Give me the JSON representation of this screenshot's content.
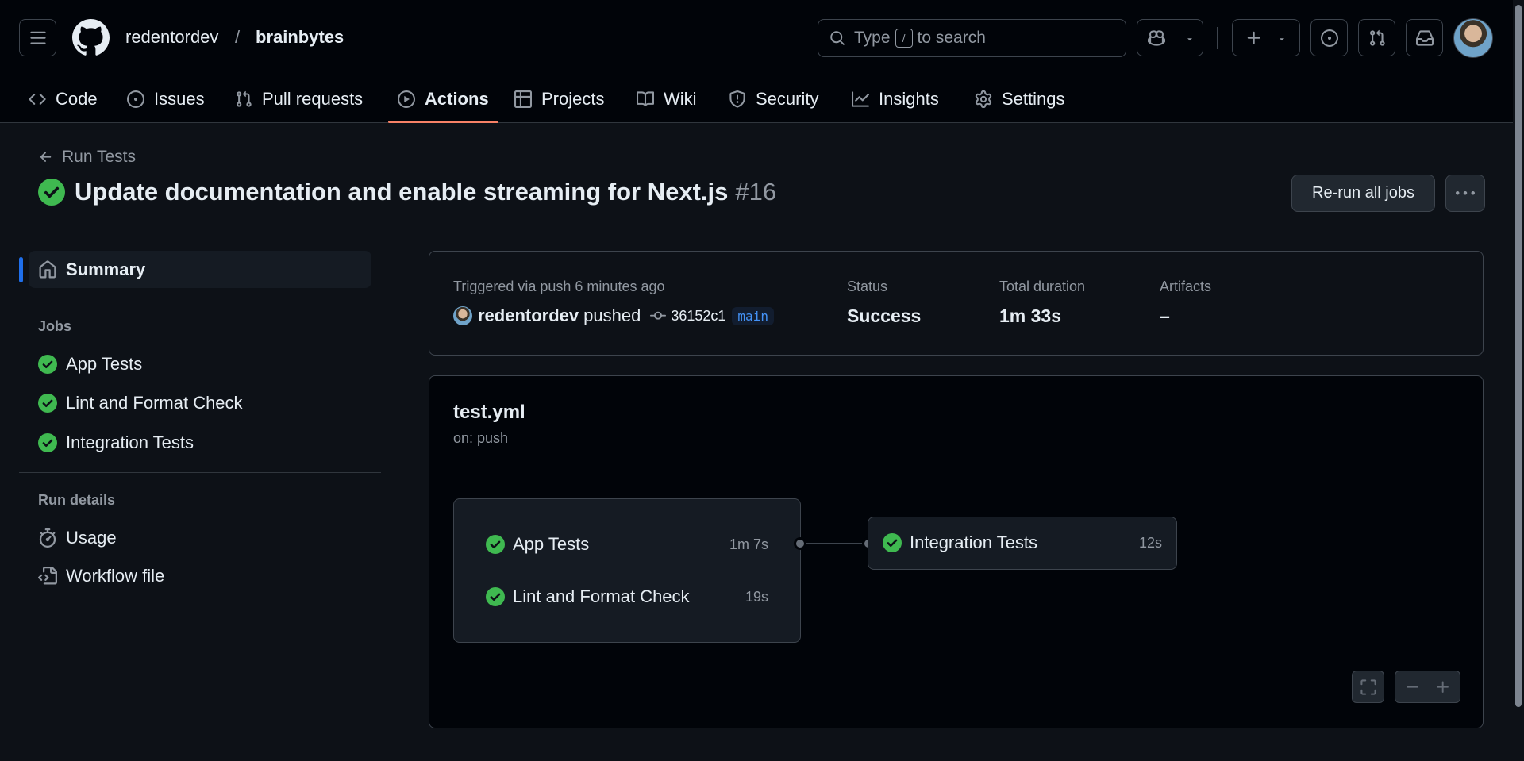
{
  "header": {
    "owner": "redentordev",
    "separator": "/",
    "repo": "brainbytes",
    "search": {
      "prefix": "Type",
      "key": "/",
      "suffix": "to search"
    }
  },
  "tabs": [
    {
      "label": "Code",
      "icon": "code-icon",
      "active": false
    },
    {
      "label": "Issues",
      "icon": "issue-opened-icon",
      "active": false
    },
    {
      "label": "Pull requests",
      "icon": "git-pull-request-icon",
      "active": false
    },
    {
      "label": "Actions",
      "icon": "play-icon",
      "active": true
    },
    {
      "label": "Projects",
      "icon": "table-icon",
      "active": false
    },
    {
      "label": "Wiki",
      "icon": "book-icon",
      "active": false
    },
    {
      "label": "Security",
      "icon": "shield-icon",
      "active": false
    },
    {
      "label": "Insights",
      "icon": "graph-icon",
      "active": false
    },
    {
      "label": "Settings",
      "icon": "gear-icon",
      "active": false
    }
  ],
  "run": {
    "back_label": "Run Tests",
    "title": "Update documentation and enable streaming for Next.js",
    "number": "#16",
    "rerun_label": "Re-run all jobs"
  },
  "sidebar": {
    "summary_label": "Summary",
    "jobs_heading": "Jobs",
    "jobs": [
      {
        "label": "App Tests",
        "status": "success"
      },
      {
        "label": "Lint and Format Check",
        "status": "success"
      },
      {
        "label": "Integration Tests",
        "status": "success"
      }
    ],
    "details_heading": "Run details",
    "details": [
      {
        "label": "Usage",
        "icon": "stopwatch-icon"
      },
      {
        "label": "Workflow file",
        "icon": "file-code-icon"
      }
    ]
  },
  "summary": {
    "trigger": "Triggered via push 6 minutes ago",
    "user": "redentordev",
    "action": "pushed",
    "commit": "36152c1",
    "branch": "main",
    "status_label": "Status",
    "status_value": "Success",
    "duration_label": "Total duration",
    "duration_value": "1m 33s",
    "artifacts_label": "Artifacts",
    "artifacts_value": "–"
  },
  "workflow": {
    "file": "test.yml",
    "trigger": "on: push",
    "group_jobs": [
      {
        "name": "App Tests",
        "duration": "1m 7s"
      },
      {
        "name": "Lint and Format Check",
        "duration": "19s"
      }
    ],
    "downstream_job": {
      "name": "Integration Tests",
      "duration": "12s"
    }
  },
  "colors": {
    "success": "#3fb950",
    "accent_underline": "#f78166",
    "selected_bar": "#1f6feb",
    "branch_text": "#4493f8"
  }
}
